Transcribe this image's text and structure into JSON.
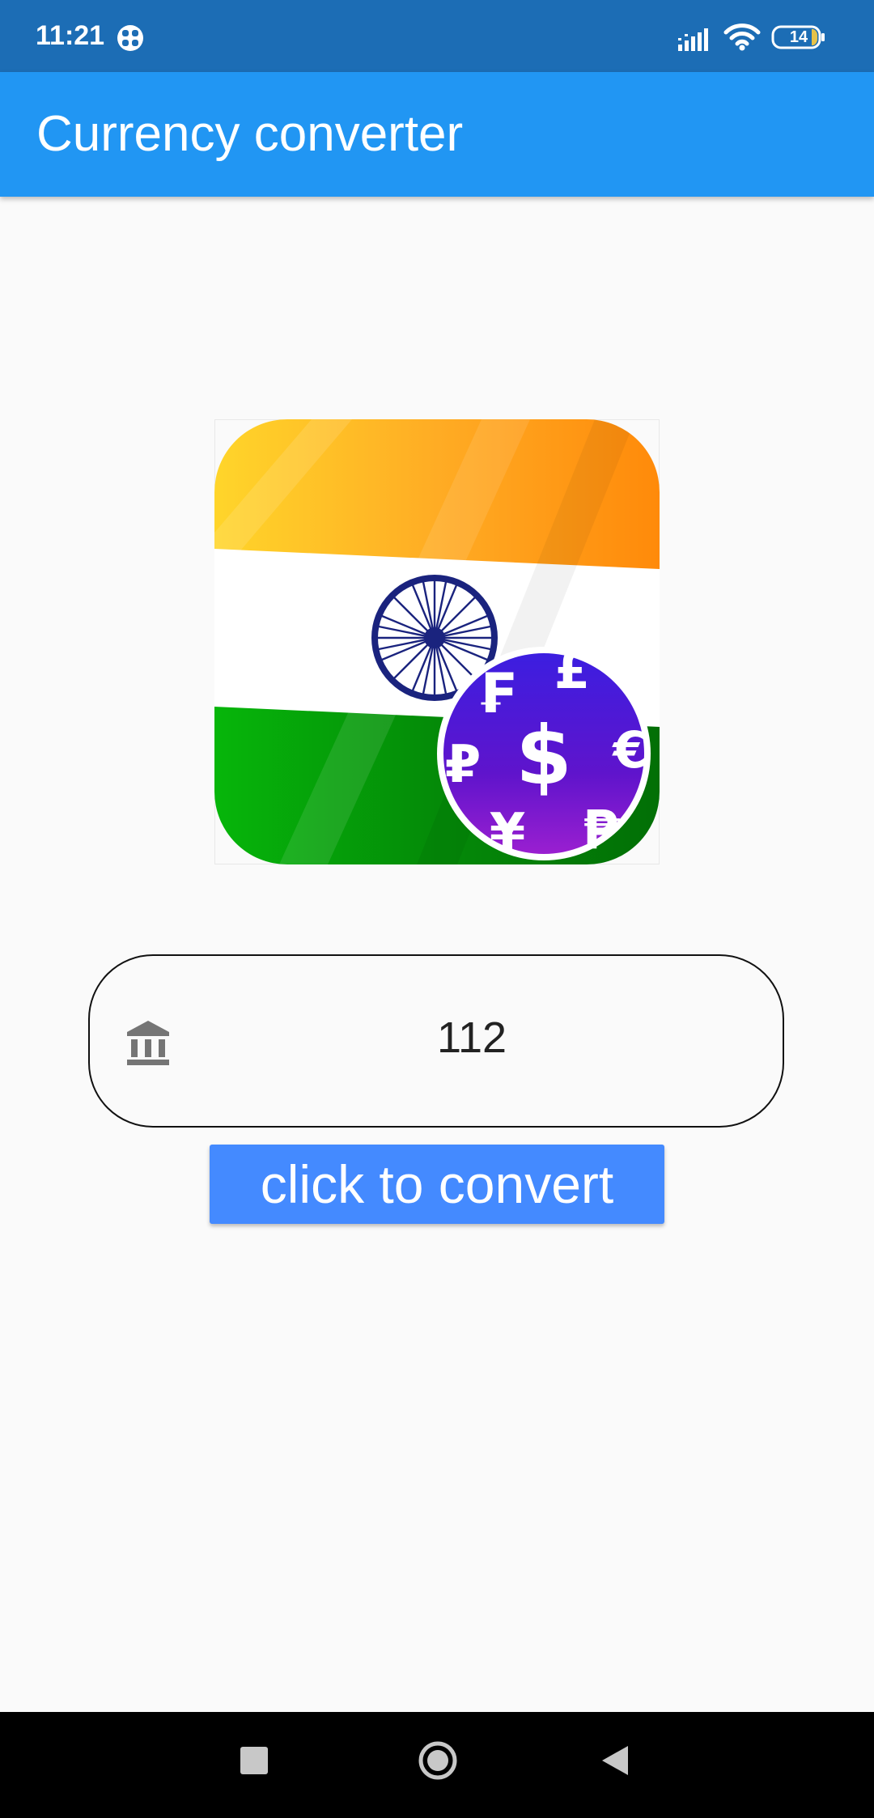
{
  "status_bar": {
    "time": "11:21",
    "battery_level": "14",
    "icons": [
      "notification-icon",
      "signal-icon",
      "wifi-icon",
      "battery-icon"
    ]
  },
  "app_bar": {
    "title": "Currency converter"
  },
  "logo": {
    "name": "india-flag-currency-logo",
    "currency_symbols": [
      "₣",
      "£",
      "₽",
      "$",
      "€",
      "¥",
      "₱"
    ],
    "colors": {
      "saffron": "#ff9a1a",
      "white": "#ffffff",
      "green": "#0a8a0a",
      "chakra": "#1a237e",
      "coin": "#5b18c9"
    }
  },
  "amount": {
    "value": "112",
    "icon": "bank-icon"
  },
  "convert_button": {
    "label": "click to convert"
  },
  "nav_bar": {
    "icons": [
      "recents-icon",
      "home-icon",
      "back-icon"
    ]
  },
  "colors": {
    "status_bar": "#1c6db5",
    "app_bar": "#2196f3",
    "button": "#448aff",
    "background": "#fafafa"
  }
}
